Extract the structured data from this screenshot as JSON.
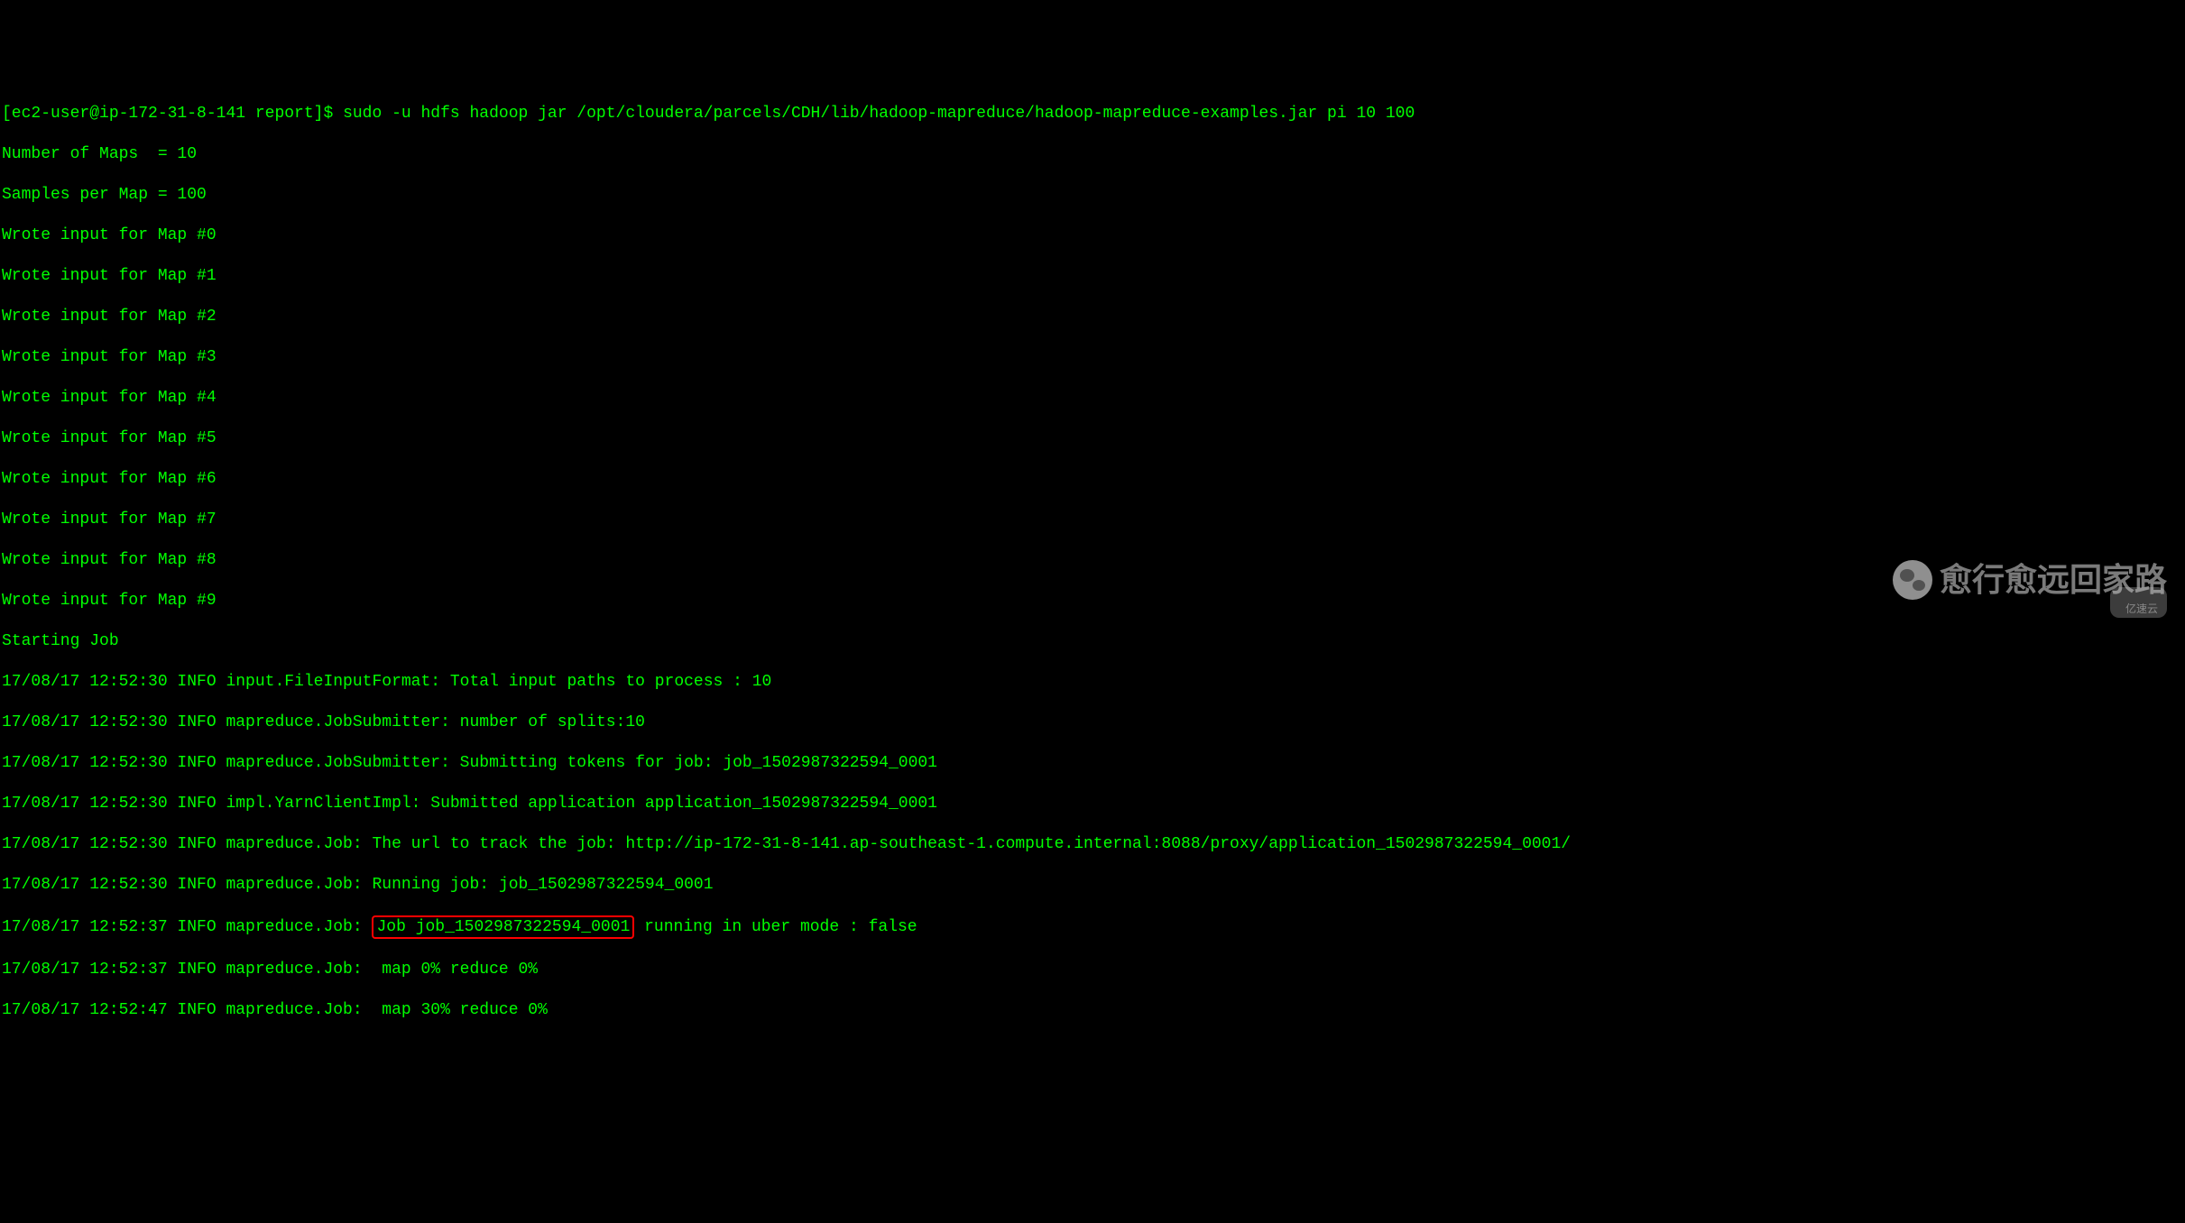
{
  "prompt": {
    "user_host": "[ec2-user@ip-172-31-8-141 report]$ ",
    "command": "sudo -u hdfs hadoop jar /opt/cloudera/parcels/CDH/lib/hadoop-mapreduce/hadoop-mapreduce-examples.jar pi 10 100"
  },
  "output": {
    "maps_line": "Number of Maps  = 10",
    "samples_line": "Samples per Map = 100",
    "wrote_inputs": [
      "Wrote input for Map #0",
      "Wrote input for Map #1",
      "Wrote input for Map #2",
      "Wrote input for Map #3",
      "Wrote input for Map #4",
      "Wrote input for Map #5",
      "Wrote input for Map #6",
      "Wrote input for Map #7",
      "Wrote input for Map #8",
      "Wrote input for Map #9"
    ],
    "starting": "Starting Job",
    "log_lines": [
      "17/08/17 12:52:30 INFO input.FileInputFormat: Total input paths to process : 10",
      "17/08/17 12:52:30 INFO mapreduce.JobSubmitter: number of splits:10",
      "17/08/17 12:52:30 INFO mapreduce.JobSubmitter: Submitting tokens for job: job_1502987322594_0001",
      "17/08/17 12:52:30 INFO impl.YarnClientImpl: Submitted application application_1502987322594_0001",
      "17/08/17 12:52:30 INFO mapreduce.Job: The url to track the job: http://ip-172-31-8-141.ap-southeast-1.compute.internal:8088/proxy/application_1502987322594_0001/"
    ],
    "running_job": "17/08/17 12:52:30 INFO mapreduce.Job: Running job: job_1502987322594_0001",
    "highlighted_prefix": "17/08/17 12:52:37 INFO mapreduce.Job: ",
    "highlighted_job": "Job job_1502987322594_0001",
    "highlighted_suffix": " running in uber mode : false",
    "progress_lines": [
      "17/08/17 12:52:37 INFO mapreduce.Job:  map 0% reduce 0%",
      "17/08/17 12:52:47 INFO mapreduce.Job:  map 30% reduce 0%"
    ]
  },
  "watermark": {
    "main": "愈行愈远回家路",
    "sub": "亿速云"
  }
}
